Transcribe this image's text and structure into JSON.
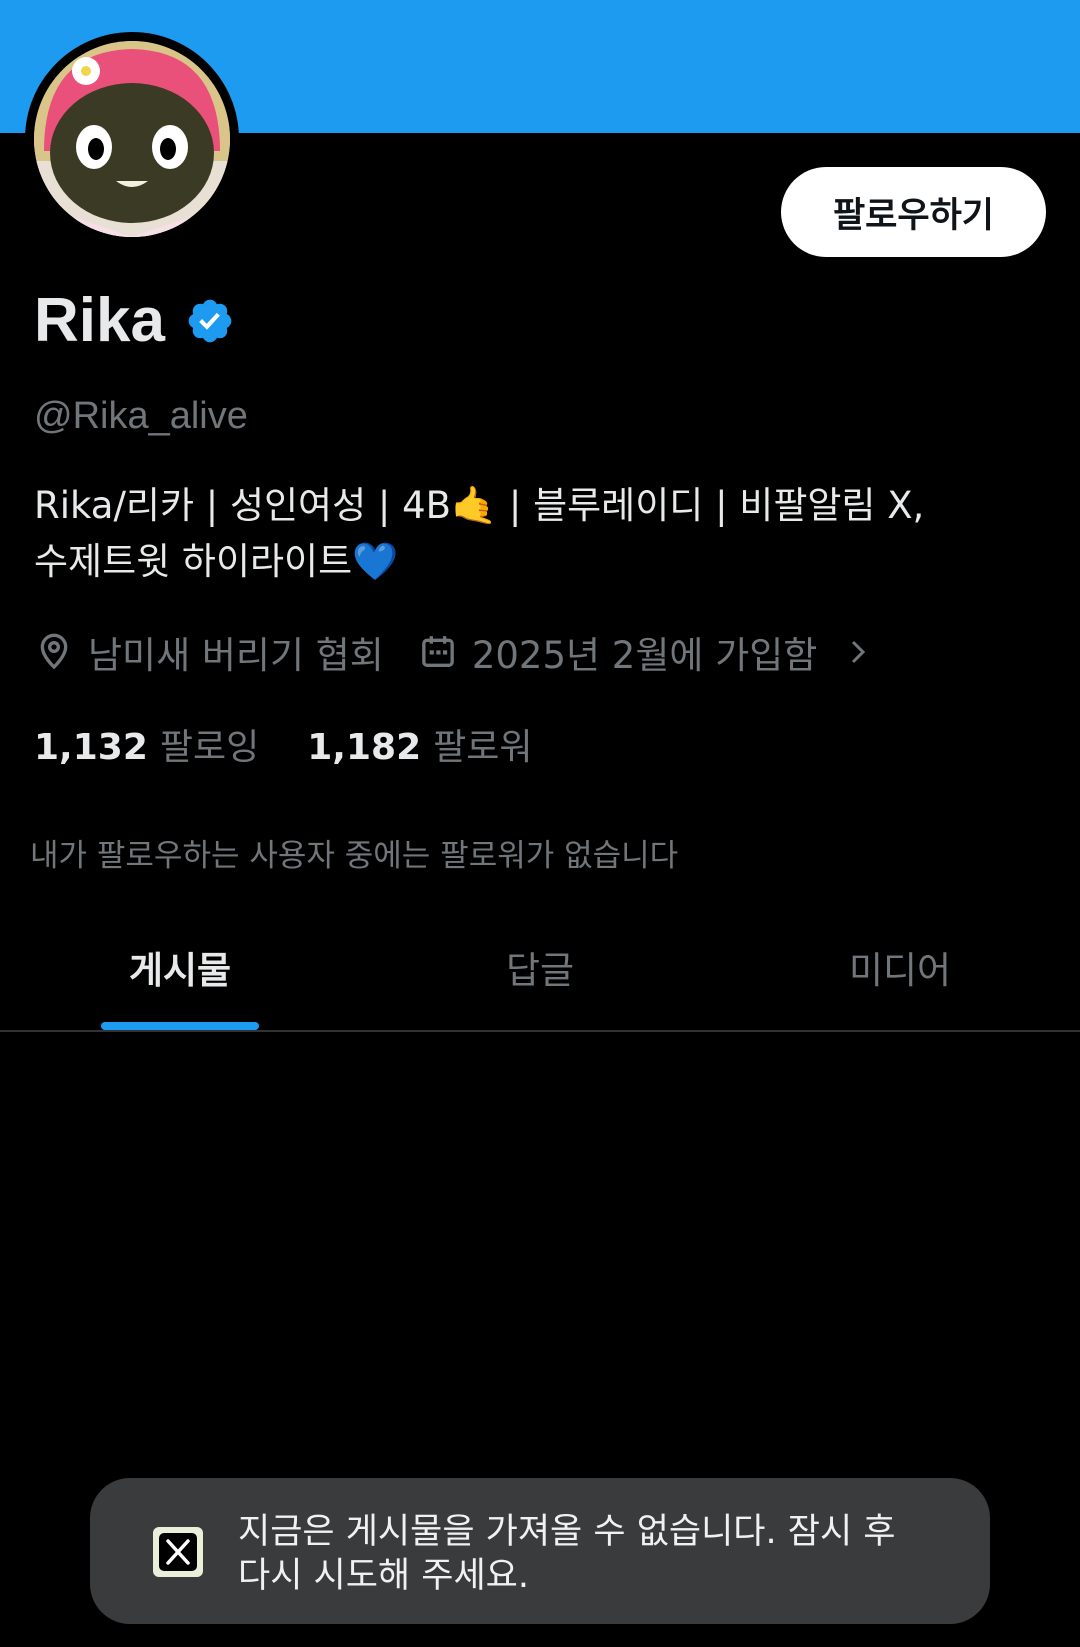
{
  "profile": {
    "display_name": "Rika",
    "handle": "@Rika_alive",
    "bio_line1": "Rika/리카 | 성인여성 | 4B🤙 | 블루레이디 | 비팔알림 X,",
    "bio_line2": "수제트윗 하이라이트💙",
    "location": "남미새 버리기 협회",
    "joined": "2025년 2월에 가입함",
    "following_count": "1,132",
    "following_label": "팔로잉",
    "followers_count": "1,182",
    "followers_label": "팔로워",
    "followed_by_note": "내가 팔로우하는 사용자 중에는 팔로워가 없습니다"
  },
  "actions": {
    "follow_label": "팔로우하기"
  },
  "tabs": [
    {
      "label": "게시물",
      "active": true
    },
    {
      "label": "답글",
      "active": false
    },
    {
      "label": "미디어",
      "active": false
    }
  ],
  "toast": {
    "line1": "지금은 게시물을 가져올 수 없습니다. 잠시 후",
    "line2": "다시 시도해 주세요."
  },
  "colors": {
    "banner": "#1d9bf0",
    "accent": "#1d9bf0",
    "background": "#000000",
    "secondary_text": "#71767b"
  },
  "icons": {
    "verified": "verified-badge-icon",
    "location": "location-pin-icon",
    "calendar": "calendar-icon",
    "chevron": "chevron-right-icon",
    "app": "x-logo-icon"
  }
}
